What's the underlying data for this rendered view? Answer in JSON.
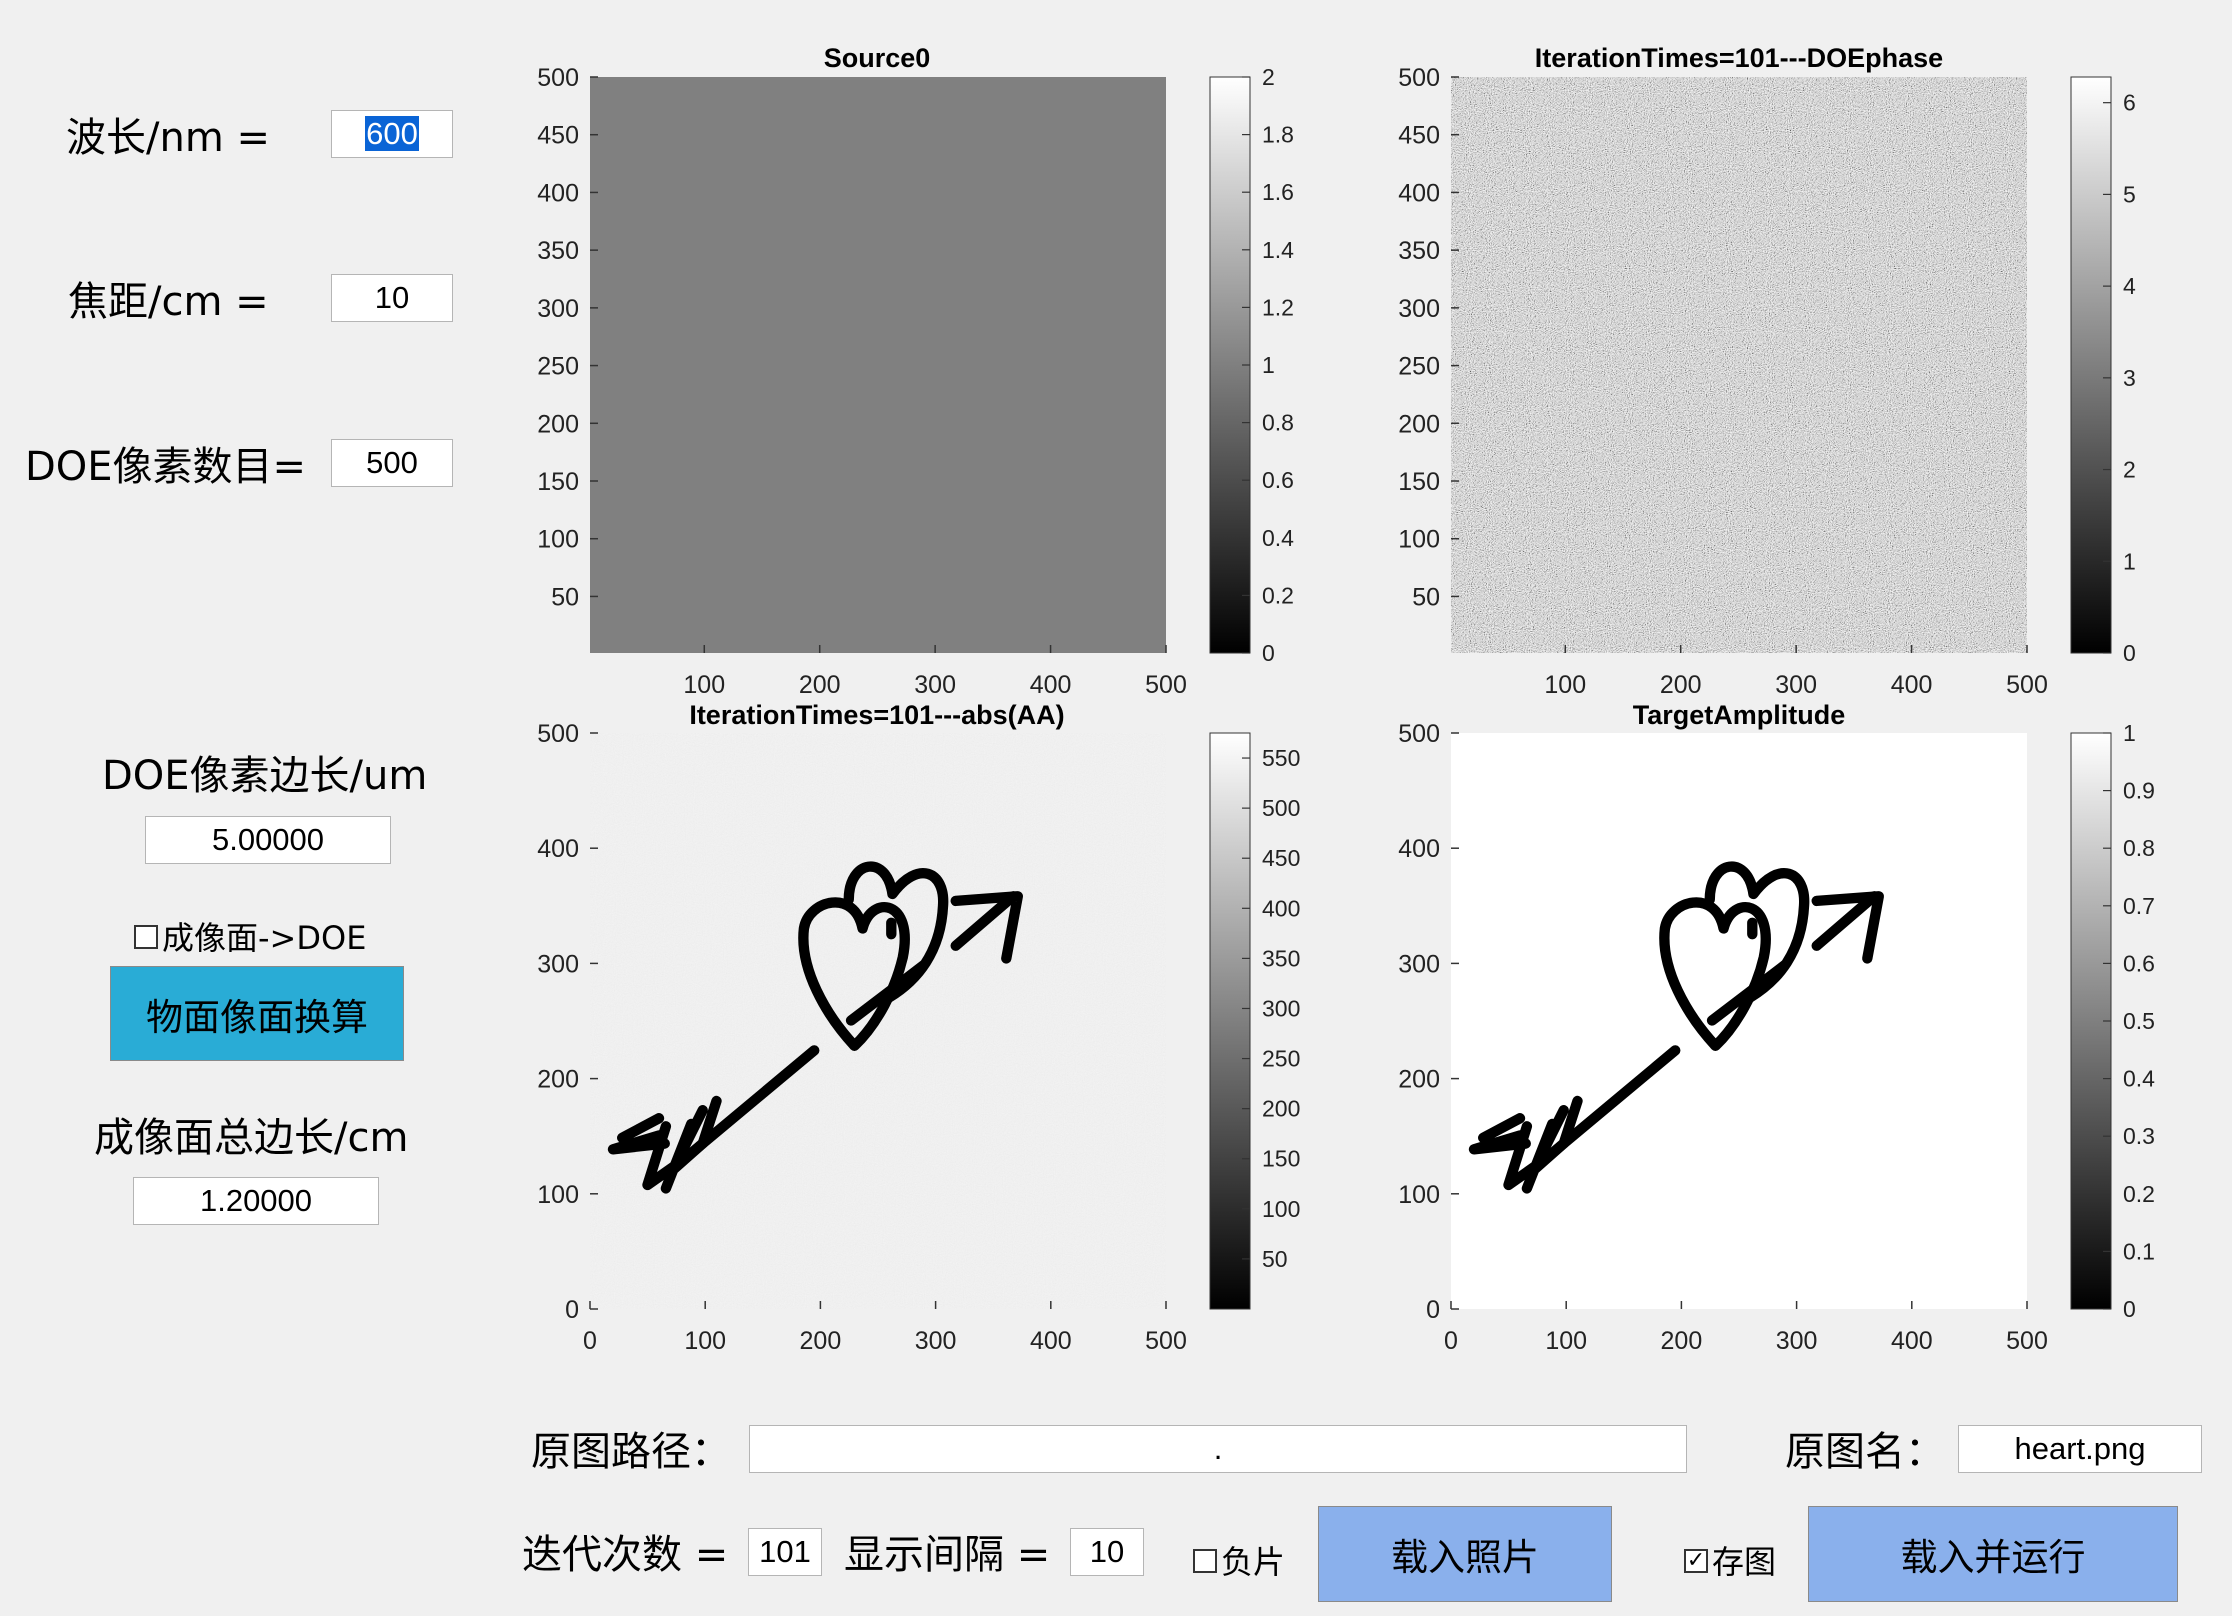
{
  "params": {
    "wavelength_label": "波长/nm =",
    "wavelength_value": "600",
    "focal_label": "焦距/cm =",
    "focal_value": "10",
    "doe_pixels_label": "DOE像素数目=",
    "doe_pixels_value": "500",
    "doe_pixel_side_label": "DOE像素边长/um",
    "doe_pixel_side_value": "5.00000",
    "image_to_doe_label": "成像面->DOE",
    "convert_button": "物面像面换算",
    "image_total_side_label": "成像面总边长/cm",
    "image_total_side_value": "1.20000"
  },
  "bottom": {
    "path_label": "原图路径：",
    "path_value": ".",
    "name_label": "原图名：",
    "name_value": "heart.png",
    "iter_label": "迭代次数 =",
    "iter_value": "101",
    "interval_label": "显示间隔 =",
    "interval_value": "10",
    "negative_label": "负片",
    "load_photo_button": "载入照片",
    "save_label": "存图",
    "load_run_button": "载入并运行"
  },
  "colors": {
    "convert_button_bg": "#29acd6",
    "load_button_bg": "#8ab0ec",
    "source_fill": "#808080"
  },
  "chart_data": [
    {
      "type": "heatmap",
      "title": "Source0",
      "content": "uniform field, value 1",
      "xticks": [
        100,
        200,
        300,
        400,
        500
      ],
      "yticks": [
        50,
        100,
        150,
        200,
        250,
        300,
        350,
        400,
        450,
        500
      ],
      "xlim": [
        1,
        500
      ],
      "ylim": [
        1,
        500
      ],
      "colorbar": {
        "range": [
          0,
          2
        ],
        "ticks": [
          "0",
          "0.2",
          "0.4",
          "0.6",
          "0.8",
          "1",
          "1.2",
          "1.4",
          "1.6",
          "1.8",
          "2"
        ]
      },
      "colormap": "gray"
    },
    {
      "type": "heatmap",
      "title": "IterationTimes=101---DOEphase",
      "content": "random phase noise",
      "xticks": [
        100,
        200,
        300,
        400,
        500
      ],
      "yticks": [
        50,
        100,
        150,
        200,
        250,
        300,
        350,
        400,
        450,
        500
      ],
      "xlim": [
        1,
        500
      ],
      "ylim": [
        1,
        500
      ],
      "colorbar": {
        "range": [
          0,
          6.28
        ],
        "ticks": [
          "0",
          "1",
          "2",
          "3",
          "4",
          "5",
          "6"
        ]
      },
      "colormap": "gray"
    },
    {
      "type": "heatmap",
      "title": "IterationTimes=101---abs(AA)",
      "content": "reconstructed heart-and-arrow drawing on light noisy background",
      "xticks": [
        0,
        100,
        200,
        300,
        400,
        500
      ],
      "yticks": [
        0,
        100,
        200,
        300,
        400,
        500
      ],
      "xlim": [
        0,
        500
      ],
      "ylim": [
        0,
        500
      ],
      "colorbar": {
        "range": [
          0,
          575
        ],
        "ticks": [
          "50",
          "100",
          "150",
          "200",
          "250",
          "300",
          "350",
          "400",
          "450",
          "500",
          "550"
        ]
      },
      "colormap": "gray"
    },
    {
      "type": "heatmap",
      "title": "TargetAmplitude",
      "content": "target heart-and-arrow drawing on white background",
      "xticks": [
        0,
        100,
        200,
        300,
        400,
        500
      ],
      "yticks": [
        0,
        100,
        200,
        300,
        400,
        500
      ],
      "xlim": [
        0,
        500
      ],
      "ylim": [
        0,
        500
      ],
      "colorbar": {
        "range": [
          0,
          1
        ],
        "ticks": [
          "0",
          "0.1",
          "0.2",
          "0.3",
          "0.4",
          "0.5",
          "0.6",
          "0.7",
          "0.8",
          "0.9",
          "1"
        ]
      },
      "colormap": "gray"
    }
  ]
}
